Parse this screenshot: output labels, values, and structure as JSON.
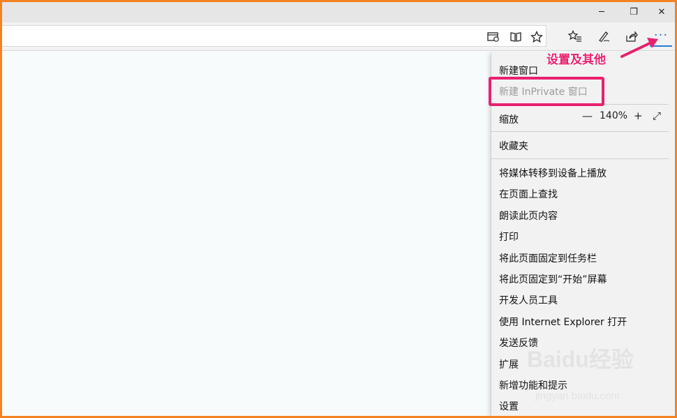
{
  "window": {
    "minimize": "─",
    "restore": "❐",
    "close": "✕"
  },
  "toolbar": {
    "reading_view_icon": "reading-view-icon",
    "book_icon": "book-icon",
    "favorite_icon": "star-icon",
    "hub_icon": "favorites-list-icon",
    "note_icon": "pen-icon",
    "share_icon": "share-icon",
    "more_label": "···"
  },
  "menu": {
    "items": [
      {
        "label": "新建窗口",
        "disabled": false
      },
      {
        "label": "新建 InPrivate 窗口",
        "disabled": true
      },
      {
        "label": "缩放",
        "disabled": false
      },
      {
        "label": "收藏夹",
        "disabled": false
      },
      {
        "label": "将媒体转移到设备上播放",
        "disabled": false
      },
      {
        "label": "在页面上查找",
        "disabled": false
      },
      {
        "label": "朗读此页内容",
        "disabled": false
      },
      {
        "label": "打印",
        "disabled": false
      },
      {
        "label": "将此页面固定到任务栏",
        "disabled": false
      },
      {
        "label": "将此页固定到“开始”屏幕",
        "disabled": false
      },
      {
        "label": "开发人员工具",
        "disabled": false
      },
      {
        "label": "使用 Internet Explorer 打开",
        "disabled": false
      },
      {
        "label": "发送反馈",
        "disabled": false
      },
      {
        "label": "扩展",
        "disabled": false
      },
      {
        "label": "新增功能和提示",
        "disabled": false
      },
      {
        "label": "设置",
        "disabled": false
      }
    ],
    "zoom": {
      "minus": "—",
      "value": "140%",
      "plus": "+",
      "fullscreen": "⤢"
    }
  },
  "annotation": {
    "text": "设置及其他",
    "color": "#e8216f"
  },
  "watermark": {
    "text": "Baidu经验",
    "url": "jingyan.baidu.com"
  },
  "colors": {
    "border": "#f58220",
    "accent": "#2b79d0",
    "highlight": "#e8216f"
  }
}
